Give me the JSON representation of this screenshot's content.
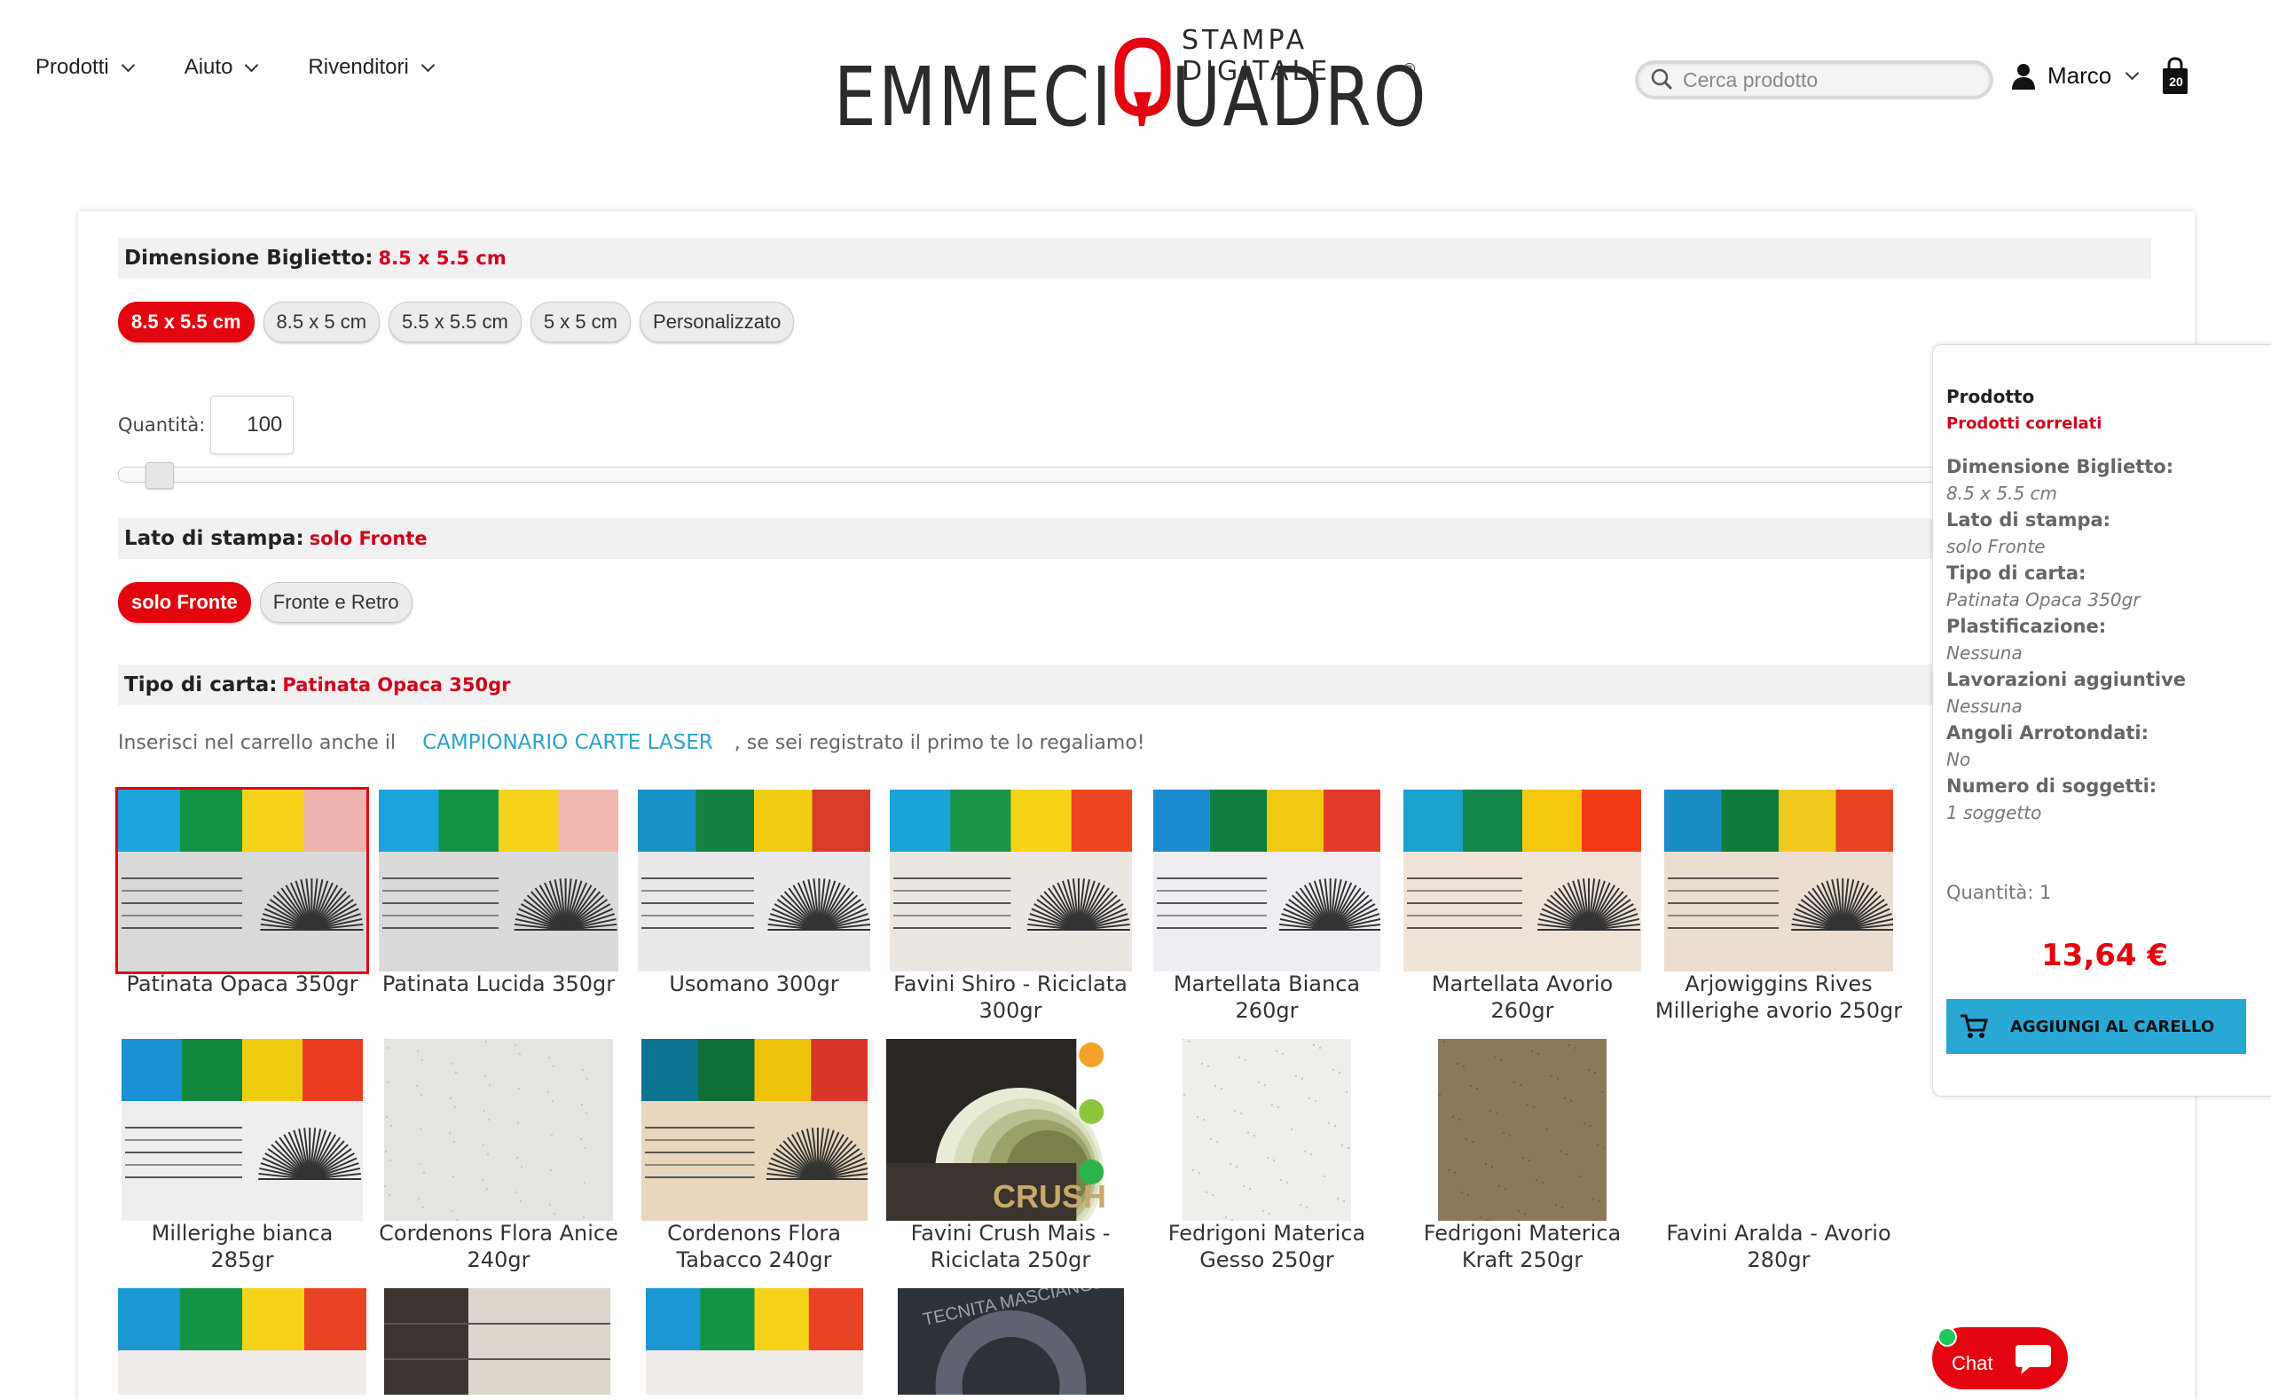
{
  "header": {
    "nav": [
      {
        "label": "Prodotti"
      },
      {
        "label": "Aiuto"
      },
      {
        "label": "Rivenditori"
      }
    ],
    "logo": {
      "main": "EMMECI",
      "main2": "UADRO",
      "sub": "STAMPA DIGITALE",
      "reg": "®"
    },
    "search": {
      "placeholder": "Cerca prodotto"
    },
    "user": {
      "name": "Marco"
    },
    "cart": {
      "count": "20"
    }
  },
  "config": {
    "dimension": {
      "label": "Dimensione Biglietto:",
      "value": "8.5 x 5.5 cm",
      "options": [
        "8.5 x 5.5 cm",
        "8.5 x 5 cm",
        "5.5 x 5.5 cm",
        "5 x 5 cm",
        "Personalizzato"
      ],
      "selected": 0
    },
    "quantity": {
      "label": "Quantità:",
      "value": "100",
      "slider_fraction": 0.01
    },
    "side": {
      "label": "Lato di stampa:",
      "value": "solo Fronte",
      "options": [
        "solo Fronte",
        "Fronte e Retro"
      ],
      "selected": 0
    },
    "paper": {
      "label": "Tipo di carta:",
      "value": "Patinata Opaca 350gr",
      "promo_before": "Inserisci nel carrello anche il",
      "promo_link": "CAMPIONARIO CARTE LASER",
      "promo_after": ", se sei registrato il primo te lo regaliamo!",
      "items": [
        {
          "name": "Patinata Opaca 350gr"
        },
        {
          "name": "Patinata Lucida 350gr"
        },
        {
          "name": "Usomano 300gr"
        },
        {
          "name": "Favini Shiro - Riciclata 300gr"
        },
        {
          "name": "Martellata Bianca 260gr"
        },
        {
          "name": "Martellata Avorio 260gr"
        },
        {
          "name": "Arjowiggins Rives Millerighe avorio 250gr"
        },
        {
          "name": "Millerighe bianca 285gr"
        },
        {
          "name": "Cordenons Flora Anice 240gr"
        },
        {
          "name": "Cordenons Flora Tabacco 240gr"
        },
        {
          "name": "Favini Crush Mais - Riciclata 250gr"
        },
        {
          "name": "Fedrigoni Materica Gesso 250gr"
        },
        {
          "name": "Fedrigoni Materica Kraft 250gr"
        },
        {
          "name": "Favini Aralda - Avorio 280gr"
        }
      ],
      "crush_text": "CRUSH",
      "masciangelo_text": "TECNITA MASCIANGELO"
    }
  },
  "summary": {
    "title": "Prodotto",
    "related": "Prodotti correlati",
    "rows": [
      {
        "k": "Dimensione Biglietto:",
        "v": "8.5 x 5.5 cm"
      },
      {
        "k": "Lato di stampa:",
        "v": "solo Fronte"
      },
      {
        "k": "Tipo di carta:",
        "v": "Patinata Opaca 350gr"
      },
      {
        "k": "Plastificazione:",
        "v": "Nessuna"
      },
      {
        "k": "Lavorazioni aggiuntive",
        "v": "Nessuna"
      },
      {
        "k": "Angoli Arrotondati:",
        "v": "No"
      },
      {
        "k": "Numero di soggetti:",
        "v": "1 soggetto"
      }
    ],
    "quantity": "Quantità: 1",
    "price": "13,64 €",
    "add_button": "AGGIUNGI AL CARELLO"
  },
  "chat": {
    "label": "Chat"
  },
  "colors": {
    "accent_red": "#e3040f",
    "link_blue": "#29a3c9",
    "button_blue": "#29a8d6"
  }
}
